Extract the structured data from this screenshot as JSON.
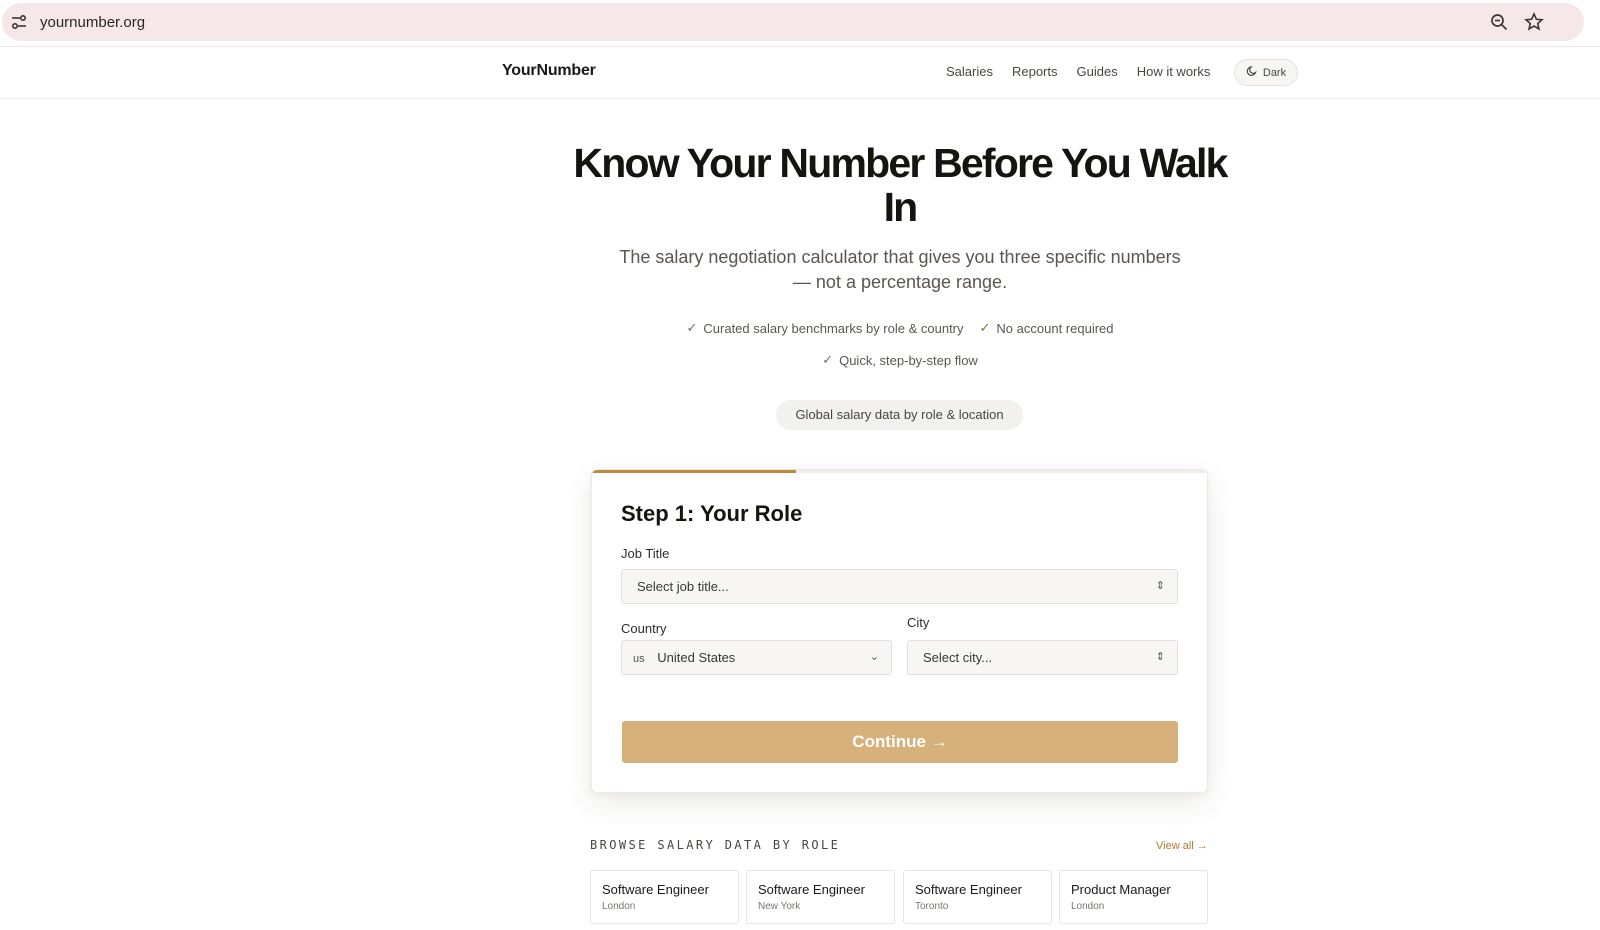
{
  "browser": {
    "url": "yournumber.org"
  },
  "header": {
    "logo": "YourNumber",
    "nav": [
      "Salaries",
      "Reports",
      "Guides",
      "How it works"
    ],
    "dark_label": "Dark"
  },
  "hero": {
    "title": "Know Your Number Before You Walk In",
    "subtitle": "The salary negotiation calculator that gives you three specific numbers — not a percentage range.",
    "features": [
      "Curated salary benchmarks by role & country",
      "No account required",
      "Quick, step-by-step flow"
    ],
    "data_pill": "Global salary data by role & location"
  },
  "form": {
    "progress": 0.33,
    "accent_color": "#c08a3c",
    "step_title": "Step 1: Your Role",
    "job_title_label": "Job Title",
    "job_title_placeholder": "Select job title...",
    "country_label": "Country",
    "country_code": "us",
    "country_value": "United States",
    "city_label": "City",
    "city_placeholder": "Select city...",
    "continue_label": "Continue →"
  },
  "browse": {
    "title": "BROWSE SALARY DATA BY ROLE",
    "view_all": "View all →",
    "roles": [
      {
        "title": "Software Engineer",
        "city": "London"
      },
      {
        "title": "Software Engineer",
        "city": "New York"
      },
      {
        "title": "Software Engineer",
        "city": "Toronto"
      },
      {
        "title": "Product Manager",
        "city": "London"
      }
    ]
  }
}
